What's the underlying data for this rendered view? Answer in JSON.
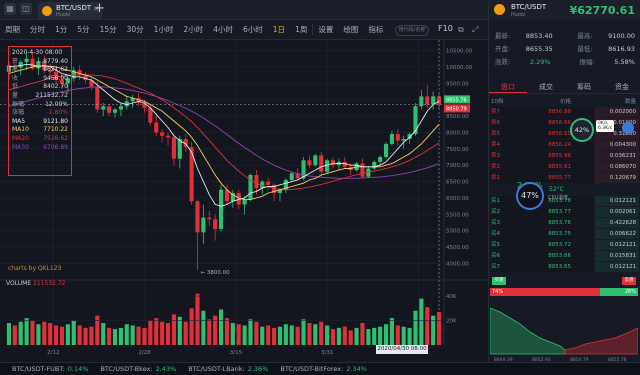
{
  "app": {
    "pair": "BTC/USDT",
    "exchange": "Huobi",
    "close_icon": "x",
    "add_icon": "plus"
  },
  "toolbar": {
    "items": [
      "周期",
      "分时",
      "1分",
      "5分",
      "15分",
      "30分",
      "1小时",
      "2小时",
      "4小时",
      "6小时",
      "1日",
      "1周"
    ],
    "active": "1日",
    "tools": [
      "设置",
      "绘图",
      "指标"
    ],
    "search_placeholder": "搜代码/名称",
    "f10": "F10"
  },
  "info_box": {
    "date": "2020-4-30 08:00",
    "rows": [
      {
        "k": "开",
        "v": "8779.40"
      },
      {
        "k": "高",
        "v": "8621.62"
      },
      {
        "k": "收",
        "v": "9456.00"
      },
      {
        "k": "低",
        "v": "8402.70"
      },
      {
        "k": "量",
        "v": "211532.72"
      },
      {
        "k": "振幅",
        "v": "12.00%"
      },
      {
        "k": "涨幅",
        "v": "-1.80%"
      },
      {
        "k": "MA5",
        "v": "9121.80"
      },
      {
        "k": "MA10",
        "v": "7710.22"
      },
      {
        "k": "MA20",
        "v": "7526.62"
      },
      {
        "k": "MA30",
        "v": "6706.89"
      }
    ],
    "ma_colors": {
      "MA5": "#e6e9ef",
      "MA10": "#f5d25b",
      "MA20": "#e0303a",
      "MA30": "#8e44ad"
    }
  },
  "watermark": "charts by QKL123",
  "volume_label": {
    "name": "VOLUME",
    "value": "211532.72"
  },
  "crosshair_date": "2020/04/30 08:00",
  "price_tags": {
    "current": "8855.76",
    "last": "8850.79"
  },
  "chart_data": {
    "type": "candlestick",
    "x_ticks": [
      "2/12",
      "2/28",
      "3/15",
      "3/31",
      "4/16"
    ],
    "y_ticks": [
      "10500.00",
      "10000.00",
      "9500.00",
      "9000.00",
      "8500.00",
      "8000.00",
      "7500.00",
      "7000.00",
      "6500.00",
      "6000.00",
      "5500.00",
      "5000.00",
      "4500.00",
      "4000.00"
    ],
    "ylim": [
      3800,
      10700
    ],
    "low_annotation": "3800.00",
    "vol_ticks": [
      "40K",
      "20K"
    ],
    "vol_ylim": [
      0,
      45000
    ],
    "candles": [
      [
        9850,
        10150,
        9600,
        10050
      ],
      [
        10050,
        10250,
        9900,
        9980
      ],
      [
        9980,
        10200,
        9750,
        10150
      ],
      [
        10150,
        10400,
        9900,
        10250
      ],
      [
        10250,
        10450,
        9900,
        9950
      ],
      [
        9950,
        10300,
        9750,
        10180
      ],
      [
        10180,
        10350,
        9800,
        9900
      ],
      [
        9900,
        10100,
        9650,
        9850
      ],
      [
        9850,
        10050,
        9500,
        9600
      ],
      [
        9600,
        9800,
        9300,
        9500
      ],
      [
        9500,
        9700,
        9200,
        9650
      ],
      [
        9650,
        10000,
        9550,
        9900
      ],
      [
        9900,
        10050,
        9600,
        9750
      ],
      [
        9750,
        9850,
        9500,
        9600
      ],
      [
        9600,
        9700,
        9300,
        9400
      ],
      [
        9400,
        9550,
        8600,
        8700
      ],
      [
        8700,
        8900,
        8500,
        8800
      ],
      [
        8800,
        8850,
        8500,
        8600
      ],
      [
        8600,
        8750,
        8450,
        8700
      ],
      [
        8700,
        8900,
        8500,
        8800
      ],
      [
        8800,
        9100,
        8700,
        8950
      ],
      [
        8950,
        9150,
        8750,
        9050
      ],
      [
        9050,
        9200,
        8800,
        8900
      ],
      [
        8900,
        9000,
        8600,
        8750
      ],
      [
        8750,
        8850,
        8200,
        8300
      ],
      [
        8300,
        8500,
        7900,
        8000
      ],
      [
        8000,
        8100,
        7700,
        7900
      ],
      [
        7900,
        8000,
        7600,
        7850
      ],
      [
        7850,
        7950,
        7000,
        7200
      ],
      [
        7200,
        7900,
        6900,
        7800
      ],
      [
        7800,
        7950,
        7400,
        7550
      ],
      [
        7550,
        7700,
        5800,
        5900
      ],
      [
        5900,
        5950,
        3800,
        4950
      ],
      [
        4950,
        5800,
        4600,
        5400
      ],
      [
        5400,
        5600,
        5150,
        5350
      ],
      [
        5350,
        5500,
        4700,
        5050
      ],
      [
        5050,
        6400,
        4950,
        6250
      ],
      [
        6250,
        6400,
        5800,
        5900
      ],
      [
        5900,
        6250,
        5700,
        6150
      ],
      [
        6150,
        6250,
        5650,
        5800
      ],
      [
        5800,
        6050,
        5500,
        5950
      ],
      [
        5950,
        6750,
        5900,
        6700
      ],
      [
        6700,
        6850,
        6100,
        6300
      ],
      [
        6300,
        6550,
        6100,
        6500
      ],
      [
        6500,
        6600,
        6250,
        6400
      ],
      [
        6400,
        6450,
        5900,
        6150
      ],
      [
        6150,
        6300,
        5900,
        6250
      ],
      [
        6250,
        6600,
        6150,
        6550
      ],
      [
        6550,
        6800,
        6500,
        6750
      ],
      [
        6750,
        6900,
        6550,
        6600
      ],
      [
        6600,
        7250,
        6550,
        7150
      ],
      [
        7150,
        7300,
        6900,
        7000
      ],
      [
        7000,
        7350,
        6950,
        7300
      ],
      [
        7300,
        7400,
        6650,
        6800
      ],
      [
        6800,
        7200,
        6750,
        7150
      ],
      [
        7150,
        7250,
        6900,
        7000
      ],
      [
        7000,
        7200,
        6850,
        7100
      ],
      [
        7100,
        7250,
        6900,
        6950
      ],
      [
        6950,
        7050,
        6700,
        6850
      ],
      [
        6850,
        7100,
        6800,
        7050
      ],
      [
        7050,
        7200,
        6600,
        6650
      ],
      [
        6650,
        6950,
        6600,
        6900
      ],
      [
        6900,
        7150,
        6850,
        7100
      ],
      [
        7100,
        7300,
        7000,
        7250
      ],
      [
        7250,
        7700,
        7200,
        7650
      ],
      [
        7650,
        8050,
        7600,
        7950
      ],
      [
        7950,
        8100,
        7600,
        7750
      ],
      [
        7750,
        7900,
        7500,
        7800
      ],
      [
        7800,
        8000,
        7650,
        7950
      ],
      [
        7950,
        8900,
        7900,
        8800
      ],
      [
        8800,
        9300,
        8700,
        9100
      ],
      [
        9100,
        9450,
        8750,
        8850
      ],
      [
        8850,
        9250,
        8700,
        9100
      ],
      [
        9100,
        9200,
        8700,
        8856
      ]
    ],
    "volumes": [
      18,
      16,
      19,
      22,
      20,
      17,
      19,
      18,
      16,
      15,
      17,
      20,
      16,
      14,
      15,
      24,
      18,
      14,
      13,
      14,
      17,
      16,
      15,
      14,
      20,
      22,
      19,
      18,
      25,
      23,
      19,
      30,
      42,
      28,
      21,
      24,
      29,
      22,
      18,
      17,
      16,
      21,
      19,
      15,
      16,
      14,
      15,
      17,
      16,
      15,
      21,
      18,
      17,
      19,
      16,
      13,
      14,
      15,
      12,
      14,
      18,
      13,
      14,
      15,
      17,
      22,
      16,
      15,
      14,
      28,
      38,
      31,
      24,
      27
    ],
    "ma5": [
      10000,
      10020,
      10040,
      10080,
      10060,
      10020,
      10040,
      10000,
      9900,
      9800,
      9750,
      9700,
      9700,
      9650,
      9600,
      9450,
      9300,
      9150,
      9000,
      8900,
      8850,
      8900,
      8950,
      8900,
      8750,
      8550,
      8350,
      8150,
      7900,
      7750,
      7650,
      7400,
      6900,
      6500,
      6100,
      5800,
      5750,
      5800,
      5900,
      5950,
      6000,
      6150,
      6200,
      6300,
      6350,
      6350,
      6400,
      6450,
      6500,
      6550,
      6650,
      6750,
      6850,
      6950,
      7000,
      7050,
      7050,
      7050,
      7000,
      7000,
      6950,
      6950,
      6950,
      7000,
      7100,
      7300,
      7500,
      7700,
      7850,
      8050,
      8350,
      8650,
      8850,
      8950
    ],
    "ma10": [
      9800,
      9850,
      9900,
      9950,
      10000,
      10020,
      10030,
      10020,
      10000,
      9950,
      9900,
      9850,
      9800,
      9750,
      9700,
      9600,
      9500,
      9400,
      9300,
      9200,
      9100,
      9050,
      9000,
      8950,
      8850,
      8750,
      8650,
      8500,
      8350,
      8200,
      8050,
      7850,
      7600,
      7300,
      7000,
      6700,
      6450,
      6250,
      6100,
      6000,
      5950,
      5950,
      6000,
      6050,
      6150,
      6200,
      6250,
      6300,
      6350,
      6400,
      6450,
      6550,
      6600,
      6700,
      6750,
      6800,
      6850,
      6900,
      6900,
      6950,
      6950,
      6950,
      6950,
      6950,
      7000,
      7050,
      7150,
      7250,
      7350,
      7500,
      7650,
      7850,
      8050,
      8250
    ],
    "ma20": [
      9300,
      9350,
      9400,
      9450,
      9500,
      9550,
      9600,
      9650,
      9700,
      9720,
      9740,
      9750,
      9760,
      9760,
      9750,
      9740,
      9720,
      9680,
      9630,
      9570,
      9500,
      9420,
      9350,
      9280,
      9200,
      9100,
      9000,
      8880,
      8750,
      8620,
      8480,
      8330,
      8150,
      7950,
      7750,
      7550,
      7350,
      7150,
      6980,
      6820,
      6680,
      6550,
      6450,
      6380,
      6330,
      6290,
      6260,
      6250,
      6260,
      6280,
      6300,
      6330,
      6370,
      6410,
      6460,
      6510,
      6560,
      6610,
      6660,
      6710,
      6750,
      6790,
      6820,
      6860,
      6900,
      6950,
      7000,
      7070,
      7150,
      7240,
      7340,
      7450,
      7560,
      7680
    ],
    "ma30": [
      8800,
      8850,
      8900,
      8950,
      9000,
      9050,
      9100,
      9150,
      9200,
      9240,
      9280,
      9310,
      9340,
      9360,
      9380,
      9390,
      9390,
      9380,
      9360,
      9340,
      9310,
      9280,
      9240,
      9200,
      9150,
      9100,
      9040,
      8970,
      8900,
      8820,
      8740,
      8650,
      8550,
      8440,
      8320,
      8200,
      8070,
      7940,
      7800,
      7670,
      7540,
      7420,
      7300,
      7190,
      7090,
      7000,
      6920,
      6850,
      6790,
      6740,
      6700,
      6670,
      6650,
      6630,
      6620,
      6610,
      6600,
      6600,
      6600,
      6600,
      6610,
      6620,
      6630,
      6640,
      6660,
      6680,
      6710,
      6740,
      6780,
      6820,
      6870,
      6920,
      6980,
      7050
    ]
  },
  "right_panel": {
    "pair": "BTC/USDT",
    "exchange": "Huobi",
    "price": "¥62770.61",
    "price_color": "#2fbf71",
    "stats": [
      {
        "k": "最新:",
        "v": "8853.40",
        "k2": "最高:",
        "v2": "9100.00"
      },
      {
        "k": "开盘:",
        "v": "8655.35",
        "k2": "最低:",
        "v2": "8616.93"
      },
      {
        "k": "涨跌:",
        "v": "2.29%",
        "k2": "振幅:",
        "v2": "5.58%"
      }
    ],
    "tabs": [
      "盘口",
      "成交",
      "筹码",
      "资金"
    ],
    "active_tab": "盘口",
    "ob_header": {
      "level": "10档",
      "price": "价格",
      "amount": "数量"
    },
    "asks": [
      {
        "l": "卖7",
        "p": "8856.99",
        "a": "0.002000"
      },
      {
        "l": "卖6",
        "p": "8856.66",
        "a": "0.01000"
      },
      {
        "l": "卖5",
        "p": "8856.50",
        "a": "0.31200"
      },
      {
        "l": "卖4",
        "p": "8856.24",
        "a": "0.004300"
      },
      {
        "l": "卖3",
        "p": "8855.96",
        "a": "0.036231"
      },
      {
        "l": "卖2",
        "p": "8855.81",
        "a": "0.086070"
      },
      {
        "l": "卖1",
        "p": "8855.77",
        "a": "0.120679"
      }
    ],
    "bids": [
      {
        "l": "买1",
        "p": "8853.78",
        "a": "0.012121"
      },
      {
        "l": "买2",
        "p": "8853.77",
        "a": "0.002061"
      },
      {
        "l": "买3",
        "p": "8853.76",
        "a": "0.422628"
      },
      {
        "l": "买4",
        "p": "8853.75",
        "a": "0.006622"
      },
      {
        "l": "买5",
        "p": "8853.72",
        "a": "0.012121"
      },
      {
        "l": "买6",
        "p": "8853.66",
        "a": "0.015831"
      },
      {
        "l": "买7",
        "p": "8853.65",
        "a": "0.012121"
      }
    ],
    "mid_change": "2.29%",
    "badge_pct": "42%",
    "net_up": "0K/s",
    "net_down": "6.3K/s",
    "cpu_pct": "47%",
    "cpu_temp": "52°C",
    "cpu_label": "CPU温度",
    "depth": {
      "buy_label": "买盘",
      "sell_label": "卖盘",
      "buy_pct": "74%",
      "sell_pct": "26%",
      "x_ticks": [
        "8849.39",
        "8852.93",
        "8854.79",
        "8855.76"
      ]
    }
  },
  "ticker": [
    {
      "pair": "BTC/USDT-FUBT:",
      "chg": "0.14%",
      "c": "g"
    },
    {
      "pair": "BTC/USDT-Bkex:",
      "chg": "2.43%",
      "c": "g"
    },
    {
      "pair": "BTC/USDT-LBank:",
      "chg": "2.36%",
      "c": "g"
    },
    {
      "pair": "BTC/USDT-BitForex:",
      "chg": "2.34%",
      "c": "g"
    }
  ]
}
